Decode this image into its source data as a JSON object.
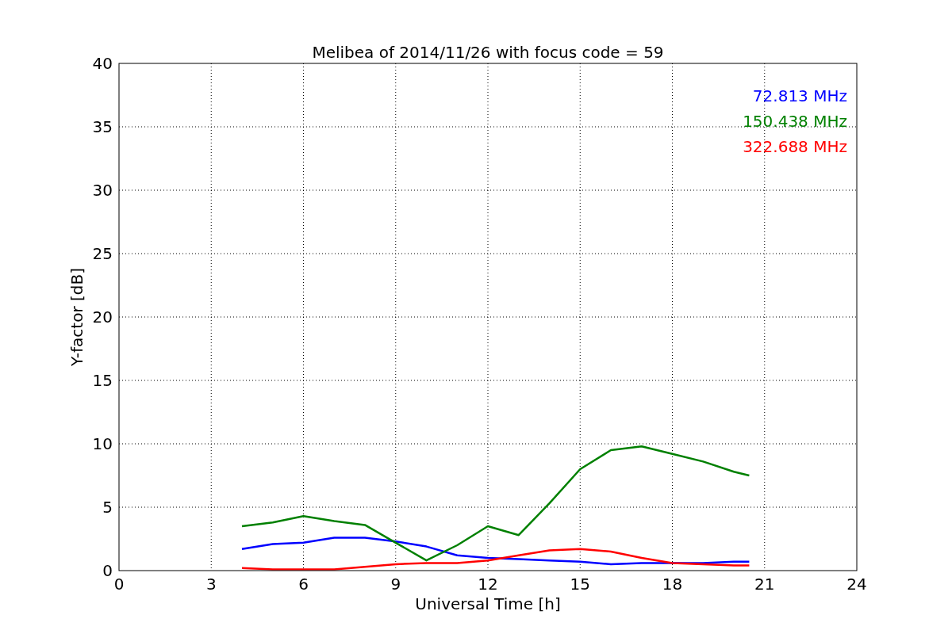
{
  "chart_data": {
    "type": "line",
    "title": "Melibea of 2014/11/26 with focus code = 59",
    "xlabel": "Universal Time [h]",
    "ylabel": "Y-factor [dB]",
    "x": [
      4,
      5,
      6,
      7,
      8,
      9,
      10,
      11,
      12,
      13,
      14,
      15,
      16,
      17,
      18,
      19,
      20,
      20.5
    ],
    "series": [
      {
        "name": "72.813 MHz",
        "color": "#0000ff",
        "values": [
          1.7,
          2.1,
          2.2,
          2.6,
          2.6,
          2.3,
          1.9,
          1.2,
          1.0,
          0.9,
          0.8,
          0.7,
          0.5,
          0.6,
          0.6,
          0.6,
          0.7,
          0.7
        ]
      },
      {
        "name": "150.438 MHz",
        "color": "#008000",
        "values": [
          3.5,
          3.8,
          4.3,
          3.9,
          3.6,
          2.2,
          0.8,
          2.0,
          3.5,
          2.8,
          5.3,
          8.0,
          9.5,
          9.8,
          9.2,
          8.6,
          7.8,
          7.5
        ]
      },
      {
        "name": "322.688 MHz",
        "color": "#ff0000",
        "values": [
          0.2,
          0.1,
          0.1,
          0.1,
          0.3,
          0.5,
          0.6,
          0.6,
          0.8,
          1.2,
          1.6,
          1.7,
          1.5,
          1.0,
          0.6,
          0.5,
          0.4,
          0.4
        ]
      }
    ],
    "grid": true,
    "xlim": [
      0,
      24
    ],
    "ylim": [
      0,
      40
    ],
    "xticks": [
      0,
      3,
      6,
      9,
      12,
      15,
      18,
      21,
      24
    ],
    "yticks": [
      0,
      5,
      10,
      15,
      20,
      25,
      30,
      35,
      40
    ]
  }
}
